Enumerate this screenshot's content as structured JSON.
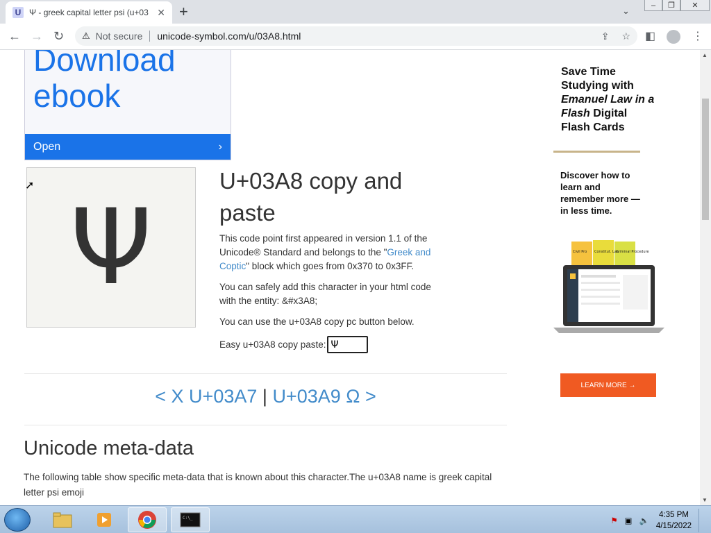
{
  "browser": {
    "tab_title": "Ψ - greek capital letter psi (u+03",
    "tab_favicon_letter": "U",
    "security_label": "Not secure",
    "url": "unicode-symbol.com/u/03A8.html"
  },
  "ad": {
    "line1": "Download",
    "line2": "ebook",
    "open_label": "Open"
  },
  "glyph": "Ψ",
  "main": {
    "heading": "U+03A8 copy and paste",
    "p1_pre": "This code point first appeared in version 1.1 of the Unicode® Standard and belongs to the \"",
    "p1_link": "Greek and Coptic",
    "p1_post": "\" block which goes from 0x370 to 0x3FF.",
    "p2": "You can safely add this character in your html code with the entity: &#x3A8;",
    "p3": "You can use the u+03A8 copy pc button below.",
    "copy_label": "Easy u+03A8 copy paste:",
    "copy_value": "Ψ"
  },
  "nav": {
    "prev": "< X U+03A7",
    "sep": "|",
    "next": "U+03A9 Ω >"
  },
  "meta": {
    "heading": "Unicode meta-data",
    "text": "The following table show specific meta-data that is known about this character.The u+03A8 name is greek capital letter psi emoji"
  },
  "sidebar_ad": {
    "h_pre": "Save Time Studying with ",
    "h_em": "Emanuel Law in a Flash",
    "h_post": " Digital Flash Cards",
    "body": "Discover how to learn and remember more —in less time.",
    "cta": "LEARN MORE",
    "book_labels": [
      "Civil Pro",
      "Constitut. Law",
      "Criminal Procedure"
    ]
  },
  "taskbar": {
    "time": "4:35 PM",
    "date": "4/15/2022"
  }
}
